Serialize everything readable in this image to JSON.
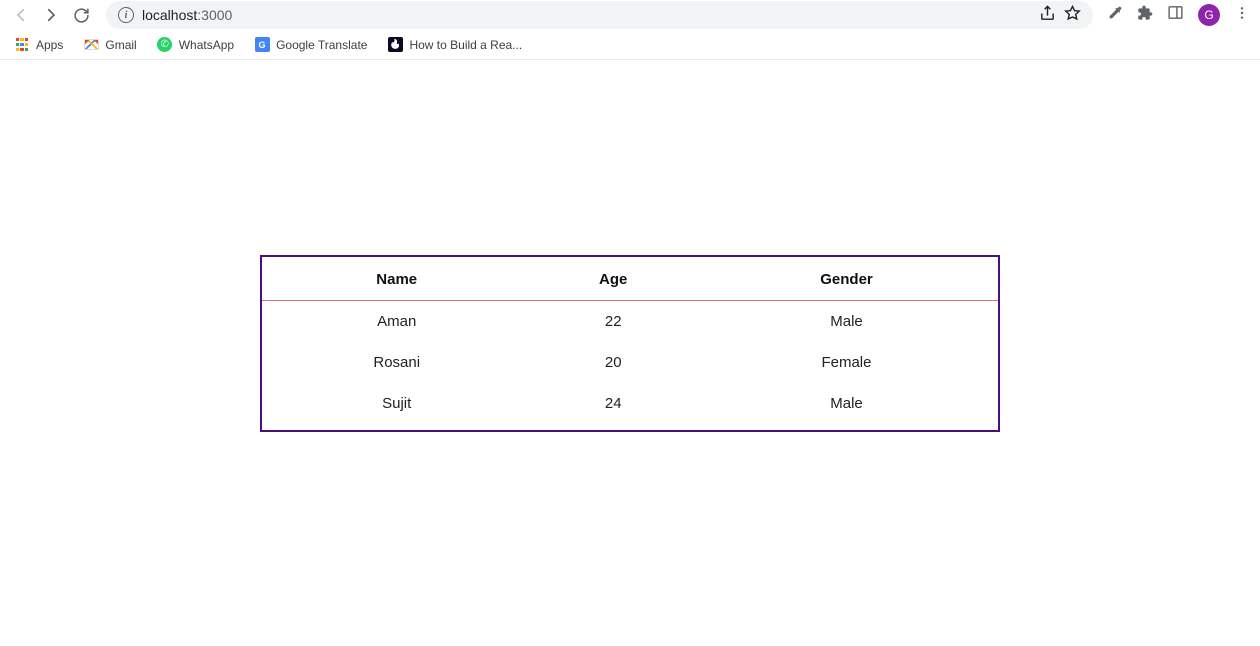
{
  "browser": {
    "url_host": "localhost",
    "url_port": ":3000",
    "avatar_initial": "G",
    "bookmarks": [
      {
        "label": "Apps"
      },
      {
        "label": "Gmail"
      },
      {
        "label": "WhatsApp"
      },
      {
        "label": "Google Translate"
      },
      {
        "label": "How to Build a Rea..."
      }
    ]
  },
  "table": {
    "headers": [
      "Name",
      "Age",
      "Gender"
    ],
    "rows": [
      {
        "name": "Aman",
        "age": "22",
        "gender": "Male"
      },
      {
        "name": "Rosani",
        "age": "20",
        "gender": "Female"
      },
      {
        "name": "Sujit",
        "age": "24",
        "gender": "Male"
      }
    ]
  }
}
